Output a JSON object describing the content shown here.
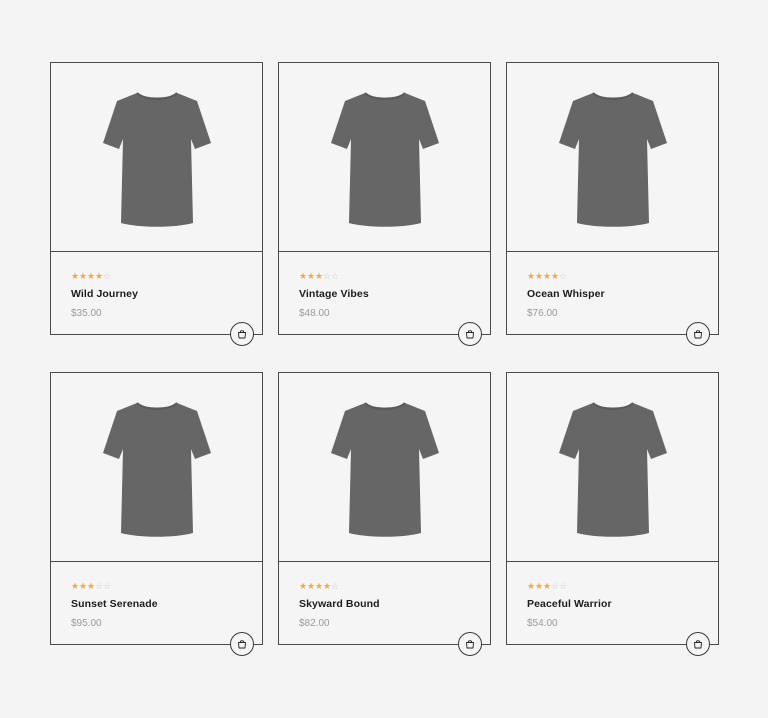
{
  "colors": {
    "background": "#f4f4f4",
    "star_filled": "#f0a847",
    "star_empty": "#c9c9c9",
    "shirt": "#666666",
    "border": "#4a4a4a"
  },
  "products": [
    {
      "name": "Wild Journey",
      "price": "$35.00",
      "rating": 4,
      "max_rating": 5,
      "image_icon": "tshirt-icon",
      "cart_icon": "shopping-bag-icon"
    },
    {
      "name": "Vintage Vibes",
      "price": "$48.00",
      "rating": 3,
      "max_rating": 5,
      "image_icon": "tshirt-icon",
      "cart_icon": "shopping-bag-icon"
    },
    {
      "name": "Ocean Whisper",
      "price": "$76.00",
      "rating": 4,
      "max_rating": 5,
      "image_icon": "tshirt-icon",
      "cart_icon": "shopping-bag-icon"
    },
    {
      "name": "Sunset Serenade",
      "price": "$95.00",
      "rating": 3,
      "max_rating": 5,
      "image_icon": "tshirt-icon",
      "cart_icon": "shopping-bag-icon"
    },
    {
      "name": "Skyward Bound",
      "price": "$82.00",
      "rating": 4,
      "max_rating": 5,
      "image_icon": "tshirt-icon",
      "cart_icon": "shopping-bag-icon"
    },
    {
      "name": "Peaceful Warrior",
      "price": "$54.00",
      "rating": 3,
      "max_rating": 5,
      "image_icon": "tshirt-icon",
      "cart_icon": "shopping-bag-icon"
    }
  ]
}
